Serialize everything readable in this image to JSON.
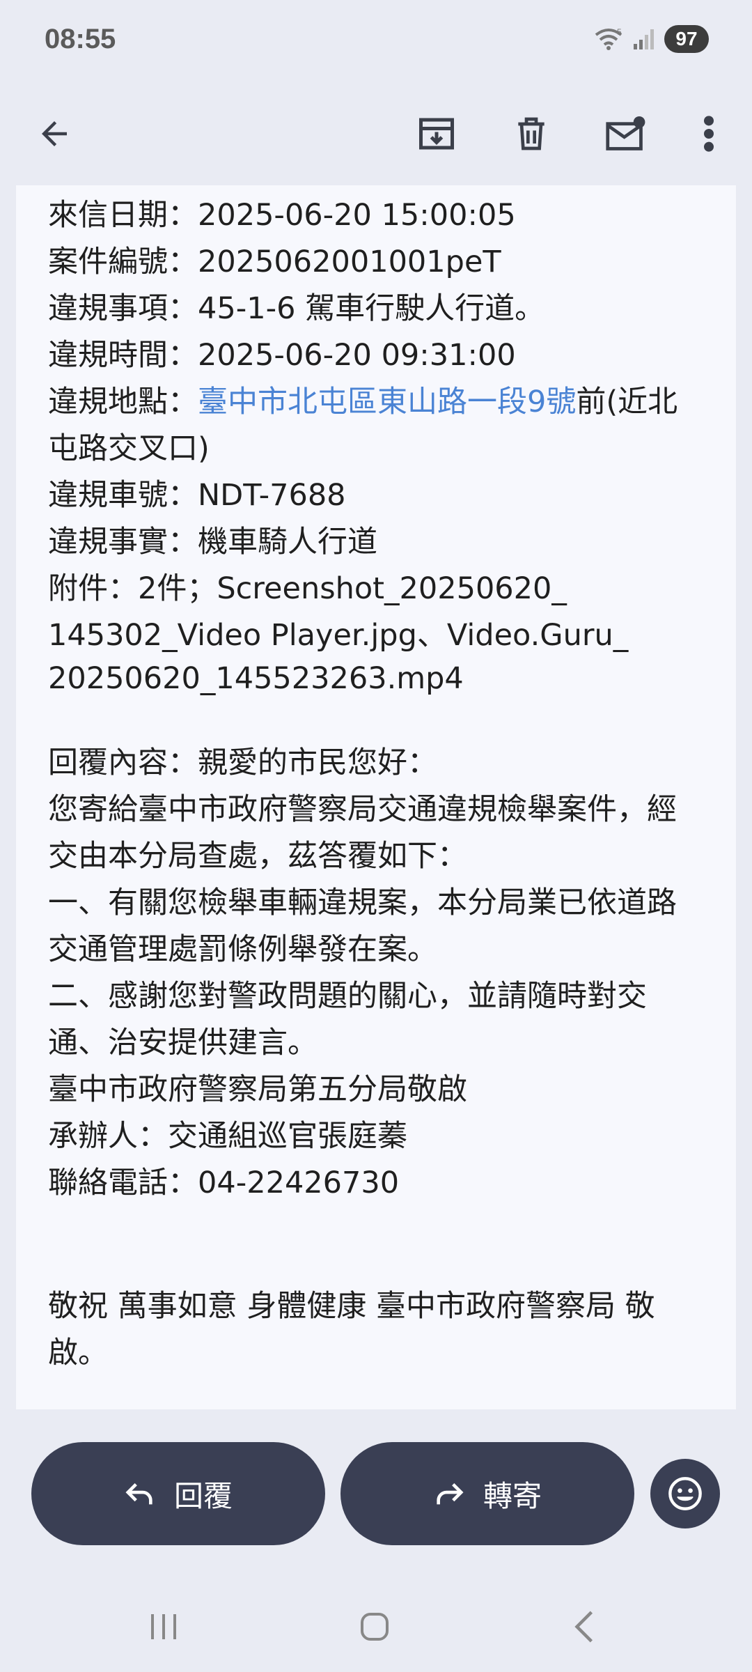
{
  "status_bar": {
    "time": "08:55",
    "battery": "97",
    "wifi_label": "5"
  },
  "email": {
    "lines": [
      "來信日期：2025-06-20 15:00:05",
      "案件編號：2025062001001peT",
      "違規事項：45-1-6 駕車行駛人行道。",
      "違規時間：2025-06-20 09:31:00"
    ],
    "location_label": "違規地點：",
    "location_link": "臺中市北屯區東山路一段9號",
    "location_suffix": "前(近北",
    "location_cont": "屯路交叉口)",
    "plate": "違規車號：NDT-7688",
    "fact": "違規事實：機車騎人行道",
    "attachment_line1": "附件：2件；Screenshot_20250620_",
    "attachment_line2": "145302_Video Player.jpg、Video.Guru_",
    "attachment_line3": "20250620_145523263.mp4",
    "reply_lines": [
      "回覆內容：親愛的市民您好：",
      "您寄給臺中市政府警察局交通違規檢舉案件，經",
      "交由本分局查處，茲答覆如下：",
      "一、有關您檢舉車輛違規案，本分局業已依道路",
      "交通管理處罰條例舉發在案。",
      "二、感謝您對警政問題的關心，並請隨時對交",
      "通、治安提供建言。",
      "臺中市政府警察局第五分局敬啟",
      "承辦人：交通組巡官張庭蓁",
      "聯絡電話：04-22426730"
    ],
    "closing_line1": "敬祝 萬事如意 身體健康 臺中市政府警察局 敬",
    "closing_line2": "啟。"
  },
  "actions": {
    "reply_label": "回覆",
    "forward_label": "轉寄"
  },
  "colors": {
    "accent_dark": "#3a3f54",
    "link": "#4a83d4",
    "background": "#e9ebf3",
    "card": "#f7f8fd"
  }
}
